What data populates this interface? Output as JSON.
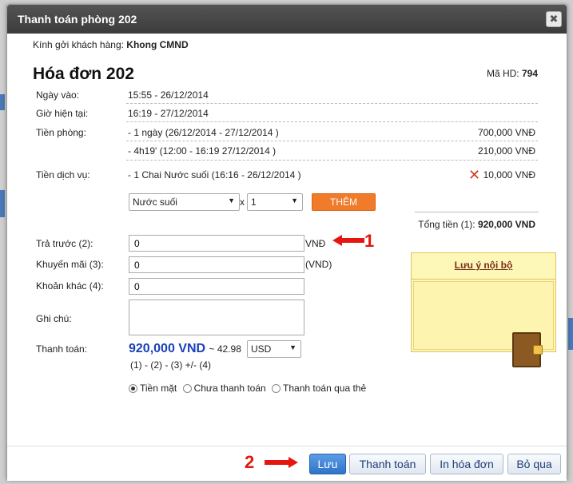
{
  "dialog": {
    "title": "Thanh toán phòng 202",
    "close_glyph": "✖"
  },
  "greeting": {
    "label": "Kính gởi khách hàng:",
    "customer": "Khong CMND"
  },
  "invoice": {
    "title": "Hóa đơn 202",
    "code_label": "Mã HD:",
    "code_value": "794"
  },
  "details": {
    "checkin_label": "Ngày vào:",
    "checkin_value": "15:55 - 26/12/2014",
    "now_label": "Giờ hiện tại:",
    "now_value": "16:19 - 27/12/2014",
    "room_label": "Tiền phòng:",
    "room_lines": [
      {
        "text": "- 1 ngày (26/12/2014 - 27/12/2014 )",
        "amount": "700,000 VNĐ"
      },
      {
        "text": "- 4h19' (12:00 - 16:19 27/12/2014 )",
        "amount": "210,000 VNĐ"
      }
    ],
    "service_label": "Tiền dịch vụ:",
    "service_line": {
      "text": "- 1 Chai Nước suối (16:16 - 26/12/2014 )",
      "amount": "10,000 VNĐ"
    },
    "delete_icon": "✕"
  },
  "add_service": {
    "item_select": "Nước suối",
    "times": "x",
    "qty_select": "1",
    "add_button": "THÊM"
  },
  "total": {
    "label": "Tổng tiền (1):",
    "value": "920,000 VND"
  },
  "form": {
    "prepaid_label": "Trả trước (2):",
    "prepaid_value": "0",
    "prepaid_unit": "VNĐ",
    "discount_label": "Khuyến mãi (3):",
    "discount_value": "0",
    "discount_unit": "(VND)",
    "other_label": "Khoản khác (4):",
    "other_value": "0",
    "note_label": "Ghi chú:",
    "note_value": "",
    "payment_label": "Thanh toán:",
    "payment_value": "920,000 VND",
    "payment_converted": "~ 42.98",
    "currency": "USD",
    "formula": "(1) - (2) - (3) +/- (4)"
  },
  "payment_methods": [
    {
      "label": "Tiền mặt",
      "checked": true
    },
    {
      "label": "Chưa thanh toán",
      "checked": false
    },
    {
      "label": "Thanh toán qua thẻ",
      "checked": false
    }
  ],
  "internal_note": {
    "title": "Lưu ý nội bộ",
    "icon": "book-icon"
  },
  "annotations": {
    "marker_1": "1",
    "marker_2": "2"
  },
  "footer": {
    "save": "Lưu",
    "pay": "Thanh toán",
    "print": "In hóa đơn",
    "skip": "Bỏ qua"
  },
  "colors": {
    "accent_orange": "#f07b2a",
    "total_blue": "#1a3fb8",
    "annotation_red": "#e3170f",
    "primary_button": "#2e73c8"
  }
}
